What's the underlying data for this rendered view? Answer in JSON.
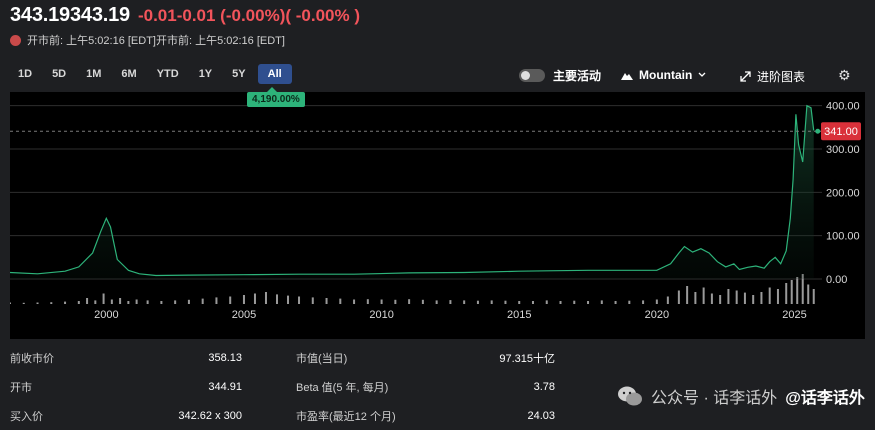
{
  "header": {
    "price": "343.19343.19",
    "change": "-0.01-0.01 (-0.00%)( -0.00% )",
    "premarket_text": "开市前: 上午5:02:16 [EDT]开市前: 上午5:02:16 [EDT]"
  },
  "range_tabs": [
    "1D",
    "5D",
    "1M",
    "6M",
    "YTD",
    "1Y",
    "5Y",
    "All"
  ],
  "active_range": "All",
  "performance_badge": "4,190.00%",
  "toolbar": {
    "toggle_label": "主要活动",
    "chart_type": "Mountain",
    "advanced_chart": "进阶图表"
  },
  "chart_data": {
    "type": "area",
    "x_ticks": [
      "2000",
      "2005",
      "2010",
      "2015",
      "2020",
      "2025"
    ],
    "y_ticks": [
      "400.00",
      "300.00",
      "200.00",
      "100.00",
      "0.00"
    ],
    "ylim": [
      -30,
      420
    ],
    "xlim": [
      1996.5,
      2026
    ],
    "current_price_label": "341.00",
    "current_price": 341,
    "line_color": "#2db37a",
    "series": [
      {
        "x": [
          1996.5,
          1997.5,
          1998.5,
          1999.0,
          1999.5,
          1999.8,
          2000.0,
          2000.15,
          2000.4,
          2000.8,
          2001.2,
          2001.8,
          2003.0,
          2005.0,
          2007.0,
          2009.0,
          2011.0,
          2013.0,
          2015.0,
          2016.0,
          2017.5,
          2019.0,
          2020.0,
          2020.5,
          2020.8,
          2021.0,
          2021.3,
          2021.6,
          2021.9,
          2022.2,
          2022.5,
          2022.8,
          2023.0,
          2023.3,
          2023.6,
          2023.9,
          2024.1,
          2024.3,
          2024.5,
          2024.7,
          2024.85,
          2024.95,
          2025.05,
          2025.15,
          2025.3,
          2025.45,
          2025.6,
          2025.7
        ],
        "y": [
          15,
          12,
          18,
          28,
          60,
          110,
          140,
          120,
          45,
          20,
          12,
          8,
          9,
          10,
          11,
          11,
          14,
          15,
          18,
          19,
          20,
          20,
          20,
          35,
          60,
          75,
          62,
          70,
          60,
          40,
          28,
          35,
          22,
          27,
          30,
          25,
          40,
          50,
          35,
          65,
          140,
          230,
          380,
          310,
          270,
          400,
          395,
          343
        ]
      }
    ],
    "volume_years": [
      1996.5,
      1997.0,
      1997.5,
      1998.0,
      1998.5,
      1999.0,
      1999.3,
      1999.6,
      1999.9,
      2000.2,
      2000.5,
      2000.8,
      2001.1,
      2001.5,
      2002.0,
      2002.5,
      2003.0,
      2003.5,
      2004.0,
      2004.5,
      2005.0,
      2005.4,
      2005.8,
      2006.2,
      2006.6,
      2007.0,
      2007.5,
      2008.0,
      2008.5,
      2009.0,
      2009.5,
      2010.0,
      2010.5,
      2011.0,
      2011.5,
      2012.0,
      2012.5,
      2013.0,
      2013.5,
      2014.0,
      2014.5,
      2015.0,
      2015.5,
      2016.0,
      2016.5,
      2017.0,
      2017.5,
      2018.0,
      2018.5,
      2019.0,
      2019.5,
      2020.0,
      2020.4,
      2020.8,
      2021.1,
      2021.4,
      2021.7,
      2022.0,
      2022.3,
      2022.6,
      2022.9,
      2023.2,
      2023.5,
      2023.8,
      2024.1,
      2024.4,
      2024.7,
      2024.9,
      2025.1,
      2025.3,
      2025.5,
      2025.7
    ],
    "volume_levels": [
      0.05,
      0.04,
      0.05,
      0.06,
      0.08,
      0.1,
      0.2,
      0.12,
      0.35,
      0.15,
      0.2,
      0.1,
      0.15,
      0.12,
      0.1,
      0.12,
      0.14,
      0.18,
      0.22,
      0.25,
      0.3,
      0.35,
      0.4,
      0.32,
      0.28,
      0.25,
      0.22,
      0.2,
      0.18,
      0.15,
      0.16,
      0.15,
      0.14,
      0.16,
      0.14,
      0.12,
      0.13,
      0.12,
      0.11,
      0.12,
      0.11,
      0.1,
      0.1,
      0.12,
      0.1,
      0.11,
      0.1,
      0.12,
      0.1,
      0.11,
      0.12,
      0.15,
      0.25,
      0.45,
      0.6,
      0.4,
      0.55,
      0.35,
      0.3,
      0.5,
      0.45,
      0.38,
      0.3,
      0.4,
      0.55,
      0.5,
      0.7,
      0.8,
      0.9,
      1.0,
      0.65,
      0.5
    ]
  },
  "stats": [
    {
      "label": "前收市价",
      "value": "358.13"
    },
    {
      "label": "市值(当日)",
      "value": "97.315十亿"
    },
    {
      "label": "开市",
      "value": "344.91"
    },
    {
      "label": "Beta 值(5 年, 每月)",
      "value": "3.78"
    },
    {
      "label": "买入价",
      "value": "342.62 x 300"
    },
    {
      "label": "市盈率(最近12 个月)",
      "value": "24.03"
    }
  ],
  "watermark": {
    "text1": "公众号 · 话李话外",
    "text2": "@话李话外"
  }
}
